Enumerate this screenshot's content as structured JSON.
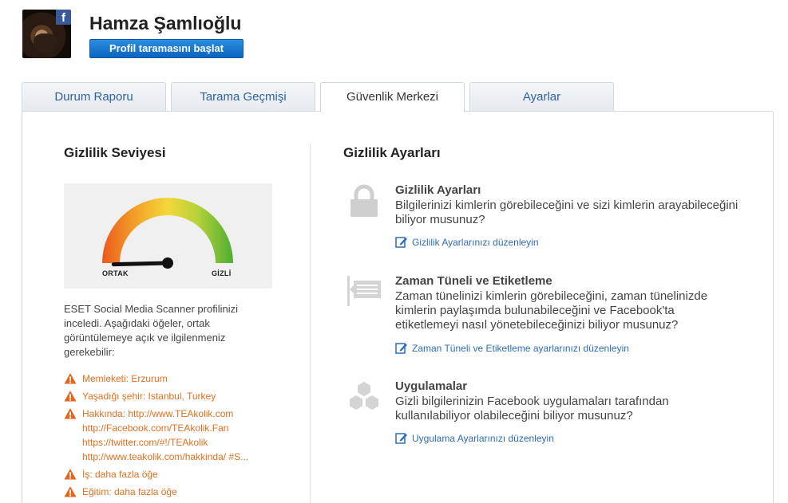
{
  "profile": {
    "name": "Hamza Şamlıoğlu",
    "scan_button": "Profil taramasını başlat",
    "fb_badge": "f"
  },
  "tabs": [
    {
      "label": "Durum Raporu",
      "active": false
    },
    {
      "label": "Tarama Geçmişi",
      "active": false
    },
    {
      "label": "Güvenlik Merkezi",
      "active": true
    },
    {
      "label": "Ayarlar",
      "active": false
    }
  ],
  "left": {
    "title": "Gizlilik Seviyesi",
    "gauge": {
      "label_left": "ORTAK",
      "label_right": "GİZLİ",
      "level": 0.03
    },
    "description": "ESET Social Media Scanner profilinizi inceledi. Aşağıdaki öğeler, ortak görüntülemeye açık ve ilgilenmeniz gerekebilir:",
    "warnings": [
      {
        "lines": [
          "Memleketi: Erzurum"
        ]
      },
      {
        "lines": [
          "Yaşadığı şehir: Istanbul, Turkey"
        ]
      },
      {
        "lines": [
          "Hakkında: http://www.TEAkolik.com",
          "http://Facebook.com/TEAkolik.Fan",
          "https://twitter.com/#!/TEAkolik",
          "http://www.teakolik.com/hakkinda/ #S..."
        ]
      },
      {
        "lines": [
          "İş: daha fazla öğe"
        ]
      },
      {
        "lines": [
          "Eğitim: daha fazla öğe"
        ]
      }
    ]
  },
  "right": {
    "title": "Gizlilik Ayarları",
    "sections": [
      {
        "icon": "lock-icon",
        "title": "Gizlilik Ayarları",
        "description": "Bilgilerinizi kimlerin görebileceğini ve sizi kimlerin arayabileceğini biliyor musunuz?",
        "link": "Gizlilik Ayarlarınızı düzenleyin"
      },
      {
        "icon": "timeline-icon",
        "title": "Zaman Tüneli ve Etiketleme",
        "description": "Zaman tünelinizi kimlerin görebileceğini, zaman tünelinizde kimlerin paylaşımda bulunabileceğini ve Facebook'ta etiketlemeyi nasıl yönetebileceğinizi biliyor musunuz?",
        "link": "Zaman Tüneli ve Etiketleme ayarlarınızı düzenleyin"
      },
      {
        "icon": "apps-hexagon-icon",
        "title": "Uygulamalar",
        "description": "Gizli bilgilerinizin Facebook uygulamaları tarafından kullanılabiliyor olabileceğini biliyor musunuz?",
        "link": "Uygulama Ayarlarınızı düzenleyin"
      }
    ]
  },
  "colors": {
    "accent": "#2f6db5",
    "warning": "#e07020",
    "button": "#0c64bf"
  }
}
